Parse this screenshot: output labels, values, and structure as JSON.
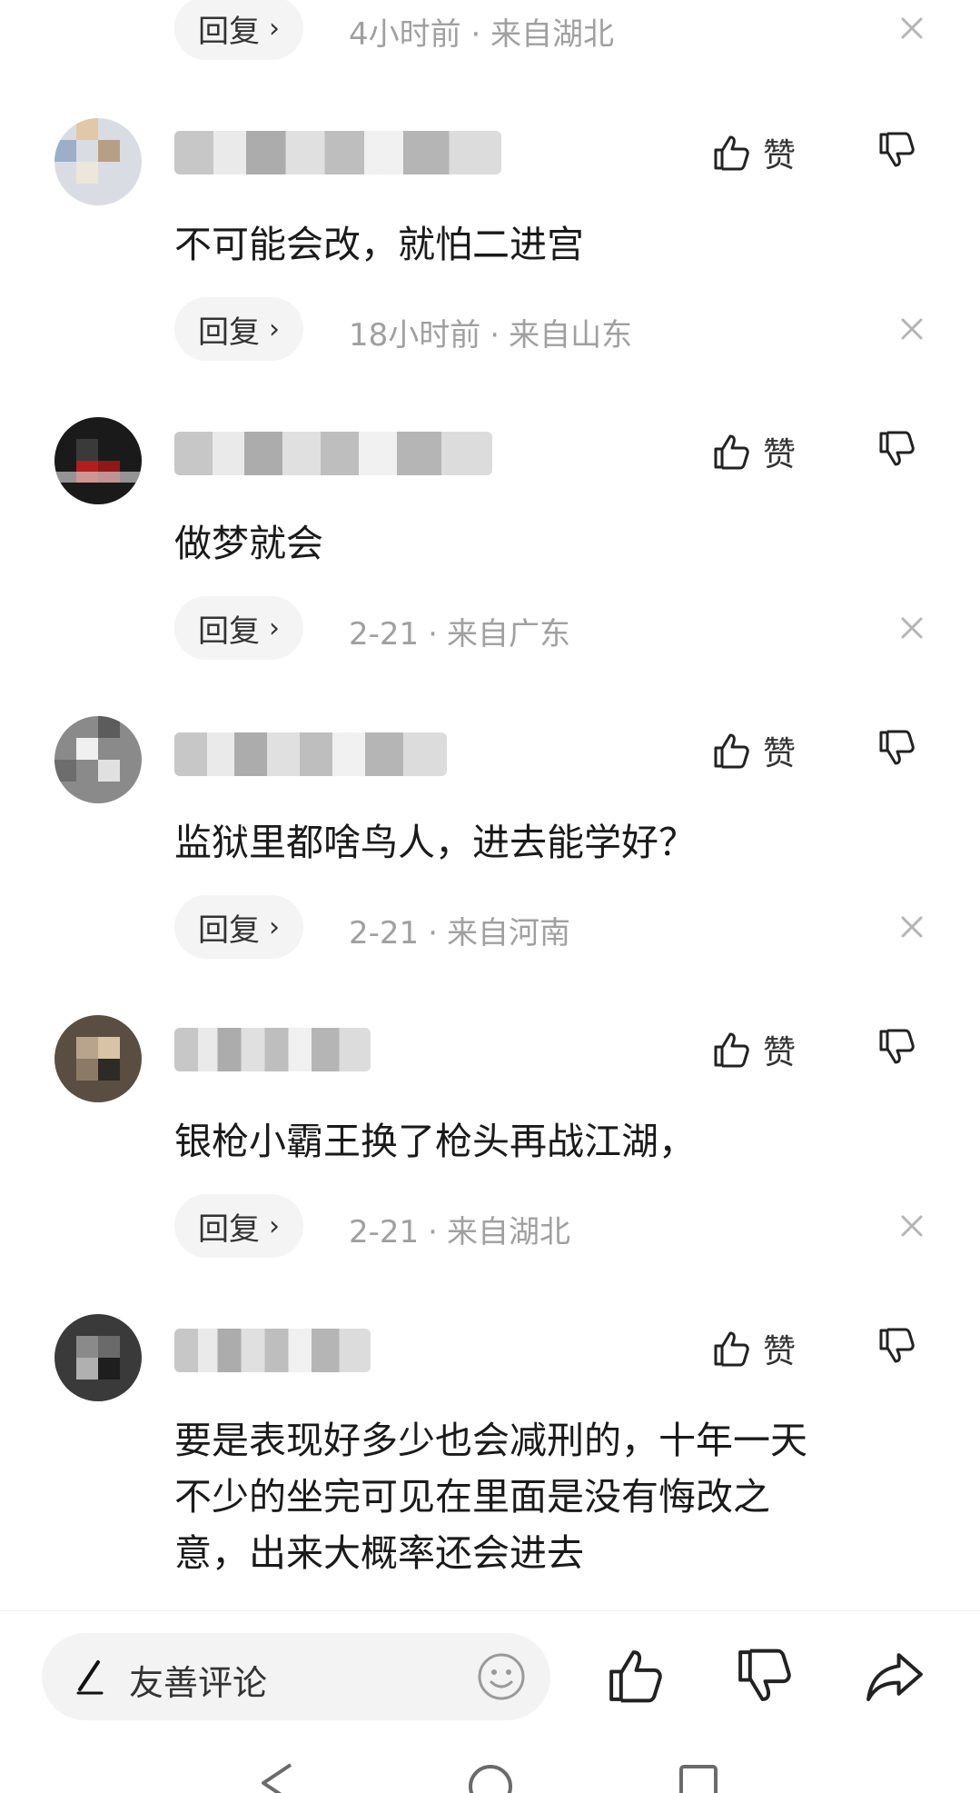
{
  "top_row": {
    "reply_label": "回复",
    "meta": "4小时前 · 来自湖北"
  },
  "like_label": "赞",
  "reply_label": "回复",
  "comments": [
    {
      "text": "不可能会改，就怕二进宫",
      "time": "18小时前",
      "location": "来自山东"
    },
    {
      "text": "做梦就会",
      "time": "2-21",
      "location": "来自广东"
    },
    {
      "text": "监狱里都啥鸟人，进去能学好？",
      "time": "2-21",
      "location": "来自河南"
    },
    {
      "text": "银枪小霸王换了枪头再战江湖，",
      "time": "2-21",
      "location": "来自湖北"
    },
    {
      "text_lines": [
        "要是表现好多少也会减刑的，十年一天",
        "不少的坐完可见在里面是没有悔改之",
        "意，出来大概率还会进去"
      ]
    }
  ],
  "bottom_bar": {
    "input_placeholder": "友善评论"
  },
  "icons": {
    "like": "thumb-up-icon",
    "dislike": "thumb-down-icon",
    "close": "close-icon",
    "pen": "pen-icon",
    "emoji": "emoji-icon",
    "share": "share-icon"
  },
  "colors": {
    "meta_gray": "#a0a0a0",
    "reply_bg": "#f4f4f4",
    "input_bg": "#f3f3f3"
  }
}
